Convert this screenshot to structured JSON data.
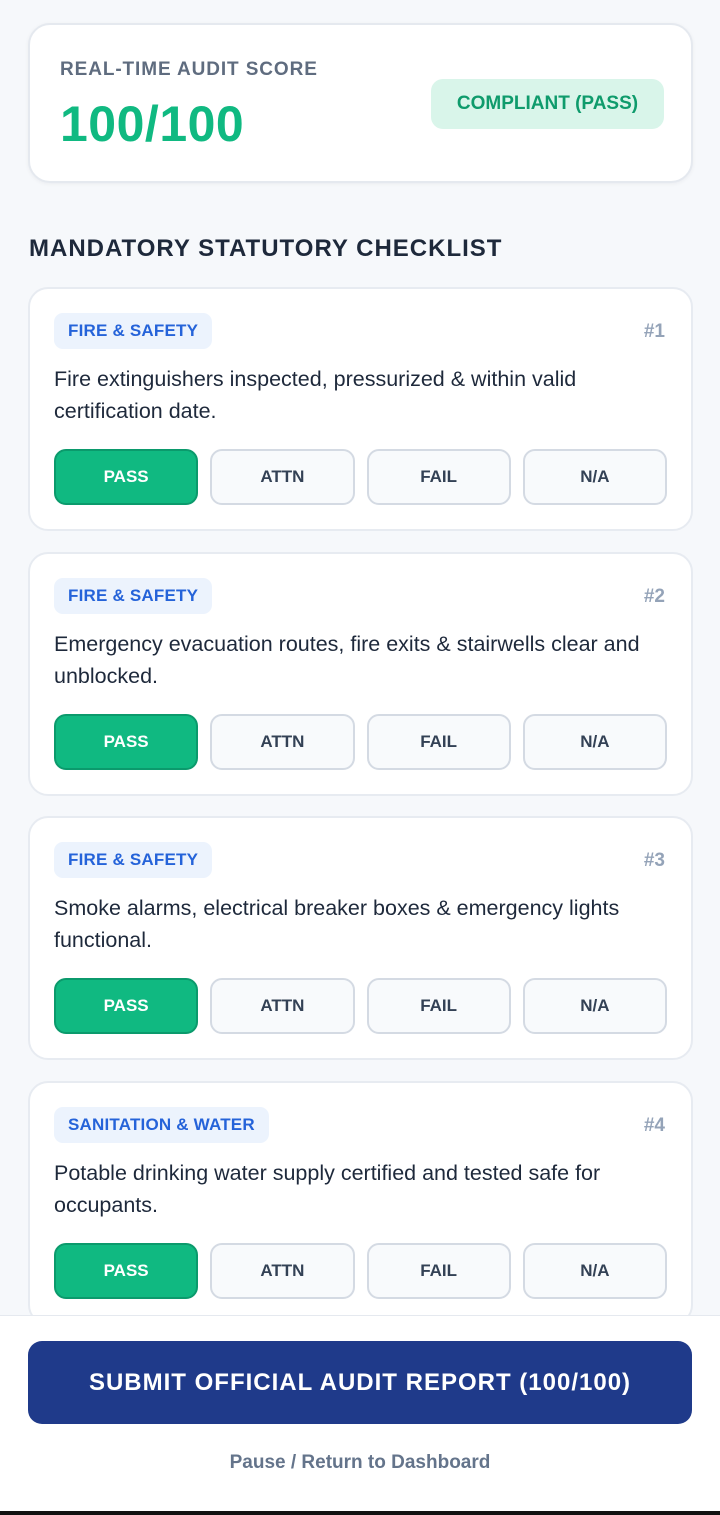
{
  "score_card": {
    "label": "REAL-TIME AUDIT SCORE",
    "value": "100/100",
    "status": "COMPLIANT (PASS)"
  },
  "checklist": {
    "title": "MANDATORY STATUTORY CHECKLIST",
    "options": [
      "PASS",
      "ATTN",
      "FAIL",
      "N/A"
    ],
    "items": [
      {
        "category": "FIRE & SAFETY",
        "number": "#1",
        "text": "Fire extinguishers inspected, pressurized & within valid certification date.",
        "selected": "PASS"
      },
      {
        "category": "FIRE & SAFETY",
        "number": "#2",
        "text": "Emergency evacuation routes, fire exits & stairwells clear and unblocked.",
        "selected": "PASS"
      },
      {
        "category": "FIRE & SAFETY",
        "number": "#3",
        "text": "Smoke alarms, electrical breaker boxes & emergency lights functional.",
        "selected": "PASS"
      },
      {
        "category": "SANITATION & WATER",
        "number": "#4",
        "text": "Potable drinking water supply certified and tested safe for occupants.",
        "selected": "PASS"
      }
    ]
  },
  "footer": {
    "submit_label": "SUBMIT OFFICIAL AUDIT REPORT (100/100)",
    "return_label": "Pause / Return to Dashboard"
  },
  "colors": {
    "accent_green": "#10b981",
    "badge_bg": "#d9f5ea",
    "tag_blue": "#2563d9",
    "submit_navy": "#1f3a8a"
  }
}
